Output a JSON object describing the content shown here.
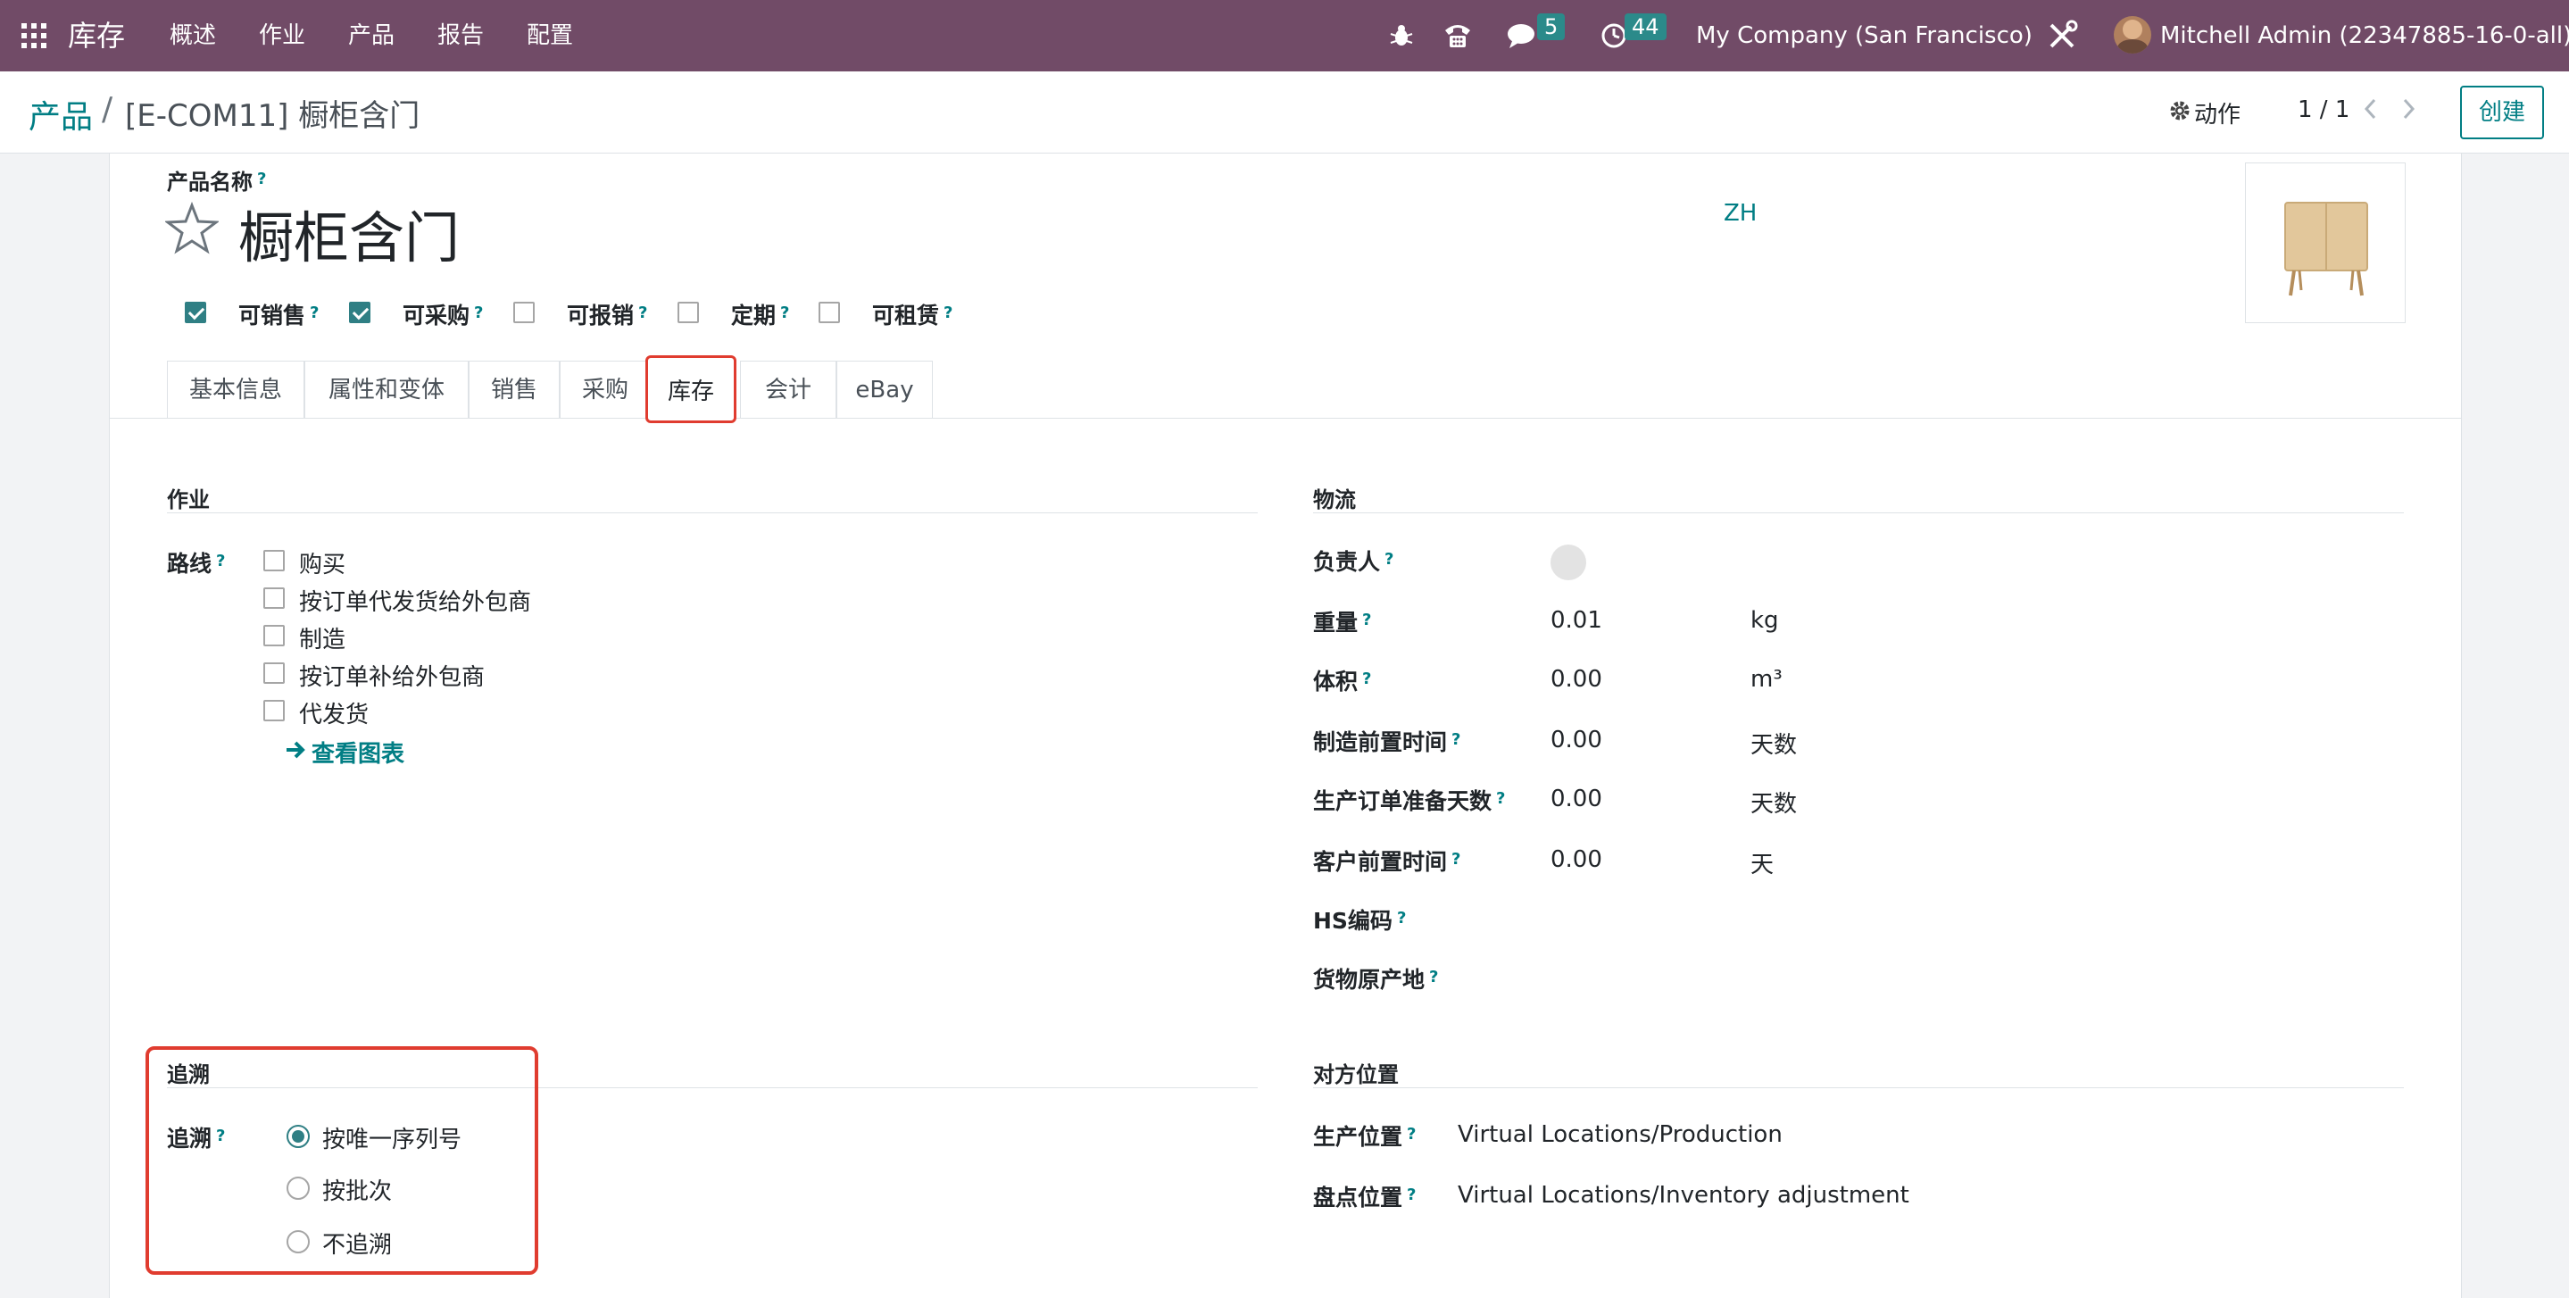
{
  "navbar": {
    "app_name": "库存",
    "menu": [
      "概述",
      "作业",
      "产品",
      "报告",
      "配置"
    ],
    "messages_count": "5",
    "activities_count": "44",
    "company": "My Company (San Francisco)",
    "user": "Mitchell Admin (22347885-16-0-all)",
    "bg_color": "#714b67"
  },
  "cpanel": {
    "breadcrumb_root": "产品",
    "breadcrumb_sep": "/",
    "record_title": "[E-COM11] 橱柜含门",
    "action_label": "动作",
    "pager": "1 / 1",
    "create_label": "创建"
  },
  "product": {
    "name_label": "产品名称",
    "help": "?",
    "name": "橱柜含门",
    "lang": "ZH",
    "flags": [
      {
        "label": "可销售",
        "checked": true
      },
      {
        "label": "可采购",
        "checked": true
      },
      {
        "label": "可报销",
        "checked": false
      },
      {
        "label": "定期",
        "checked": false
      },
      {
        "label": "可租赁",
        "checked": false
      }
    ]
  },
  "tabs": [
    "基本信息",
    "属性和变体",
    "销售",
    "采购",
    "库存",
    "会计",
    "eBay"
  ],
  "operations": {
    "title": "作业",
    "routes_label": "路线",
    "routes": [
      "购买",
      "按订单代发货给外包商",
      "制造",
      "按订单补给外包商",
      "代发货"
    ],
    "view_diagram": "查看图表"
  },
  "logistics": {
    "title": "物流",
    "responsible_label": "负责人",
    "weight_label": "重量",
    "weight_value": "0.01",
    "weight_unit": "kg",
    "volume_label": "体积",
    "volume_value": "0.00",
    "volume_unit": "m³",
    "mfg_lead_label": "制造前置时间",
    "mfg_lead_value": "0.00",
    "mfg_lead_unit": "天数",
    "prep_days_label": "生产订单准备天数",
    "prep_days_value": "0.00",
    "prep_days_unit": "天数",
    "customer_lead_label": "客户前置时间",
    "customer_lead_value": "0.00",
    "customer_lead_unit": "天",
    "hs_code_label": "HS编码",
    "origin_label": "货物原产地"
  },
  "traceability": {
    "title": "追溯",
    "label": "追溯",
    "options": [
      "按唯一序列号",
      "按批次",
      "不追溯"
    ],
    "selected_index": 0
  },
  "counterpart": {
    "title": "对方位置",
    "production_label": "生产位置",
    "production_value": "Virtual Locations/Production",
    "inventory_label": "盘点位置",
    "inventory_value": "Virtual Locations/Inventory adjustment"
  },
  "colors": {
    "accent": "#017e84",
    "highlight": "#e03c2f",
    "checkbox": "#2f7f84"
  }
}
